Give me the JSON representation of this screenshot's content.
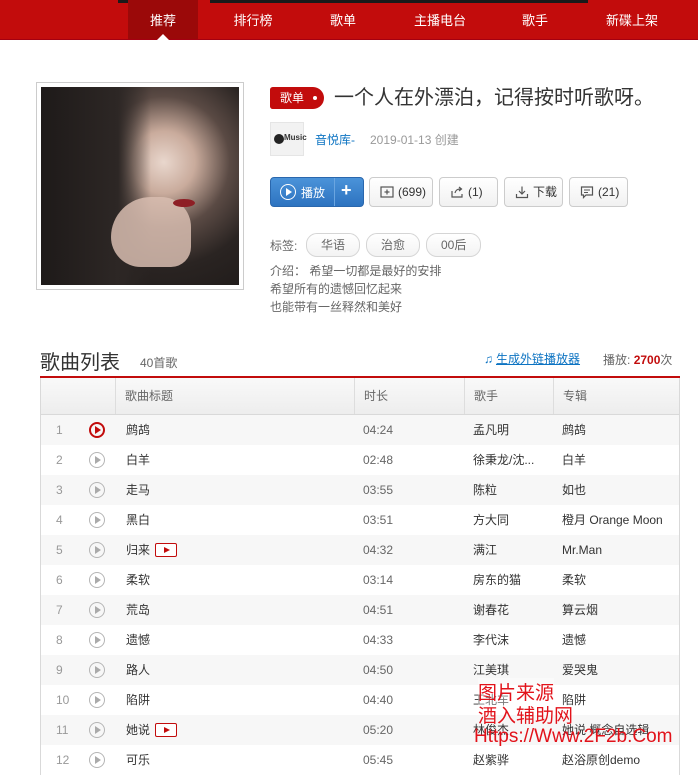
{
  "nav": {
    "items": [
      {
        "label": "推荐",
        "active": true
      },
      {
        "label": "排行榜",
        "active": false
      },
      {
        "label": "歌单",
        "active": false
      },
      {
        "label": "主播电台",
        "active": false
      },
      {
        "label": "歌手",
        "active": false
      },
      {
        "label": "新碟上架",
        "active": false
      }
    ]
  },
  "playlist": {
    "badge": "歌单",
    "title": "一个人在外漂泊，记得按时听歌呀。",
    "avatar_text": "Music",
    "creator": "音悦库-",
    "created": "2019-01-13 创建"
  },
  "actions": {
    "play": "播放",
    "plus": "+",
    "collect": "(699)",
    "share": "(1)",
    "download": "下载",
    "comment": "(21)"
  },
  "tags": {
    "label": "标签:",
    "items": [
      "华语",
      "治愈",
      "00后"
    ]
  },
  "description": {
    "lines": [
      "介绍：  希望一切都是最好的安排",
      "希望所有的遗憾回忆起来",
      "也能带有一丝释然和美好"
    ]
  },
  "songlist": {
    "title": "歌曲列表",
    "count": "40首歌",
    "ext_link": "生成外链播放器",
    "play_label": "播放:",
    "play_count": "2700",
    "play_unit": "次",
    "columns": [
      "歌曲标题",
      "时长",
      "歌手",
      "专辑"
    ],
    "rows": [
      {
        "num": "1",
        "name": "鹧鸪",
        "mv": false,
        "duration": "04:24",
        "artist": "孟凡明",
        "album": "鹧鸪",
        "current": true
      },
      {
        "num": "2",
        "name": "白羊",
        "mv": false,
        "duration": "02:48",
        "artist": "徐秉龙/沈...",
        "album": "白羊",
        "current": false
      },
      {
        "num": "3",
        "name": "走马",
        "mv": false,
        "duration": "03:55",
        "artist": "陈粒",
        "album": "如也",
        "current": false
      },
      {
        "num": "4",
        "name": "黑白",
        "mv": false,
        "duration": "03:51",
        "artist": "方大同",
        "album": "橙月 Orange Moon",
        "current": false
      },
      {
        "num": "5",
        "name": "归来",
        "mv": true,
        "duration": "04:32",
        "artist": "满江",
        "album": "Mr.Man",
        "current": false
      },
      {
        "num": "6",
        "name": "柔软",
        "mv": false,
        "duration": "03:14",
        "artist": "房东的猫",
        "album": "柔软",
        "current": false
      },
      {
        "num": "7",
        "name": "荒岛",
        "mv": false,
        "duration": "04:51",
        "artist": "谢春花",
        "album": "算云烟",
        "current": false
      },
      {
        "num": "8",
        "name": "遗憾",
        "mv": false,
        "duration": "04:33",
        "artist": "李代沫",
        "album": "遗憾",
        "current": false
      },
      {
        "num": "9",
        "name": "路人",
        "mv": false,
        "duration": "04:50",
        "artist": "江美琪",
        "album": "爱哭鬼",
        "current": false
      },
      {
        "num": "10",
        "name": "陷阱",
        "mv": false,
        "duration": "04:40",
        "artist": "王北车",
        "album": "陷阱",
        "current": false
      },
      {
        "num": "11",
        "name": "她说",
        "mv": true,
        "duration": "05:20",
        "artist": "林俊杰",
        "album": "她说 概念自选辑",
        "current": false
      },
      {
        "num": "12",
        "name": "可乐",
        "mv": false,
        "duration": "05:45",
        "artist": "赵紫骅",
        "album": "赵浴原创demo",
        "current": false
      }
    ]
  },
  "watermark": {
    "line1": "图片来源",
    "line2": "酒入辅助网",
    "line3": "Https://Www.2F2b.Com"
  }
}
